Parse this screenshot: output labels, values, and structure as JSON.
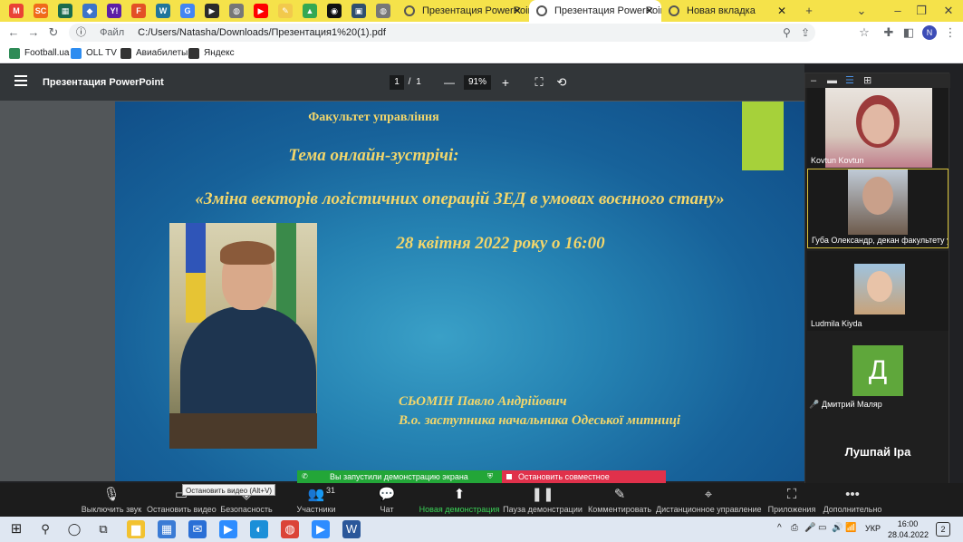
{
  "browser": {
    "mini_tabs": [
      {
        "icon": "gmail-icon",
        "glyph": "M",
        "color": "#ea4335"
      },
      {
        "icon": "sc-icon",
        "glyph": "SC",
        "color": "#f06a1b"
      },
      {
        "icon": "grid-app-icon",
        "glyph": "▦",
        "color": "#1a6b4d"
      },
      {
        "icon": "diamond-app-icon",
        "glyph": "◆",
        "color": "#3c74c9"
      },
      {
        "icon": "yahoo-icon",
        "glyph": "Y!",
        "color": "#5c1ea6"
      },
      {
        "icon": "f-app-icon",
        "glyph": "F",
        "color": "#e34f26"
      },
      {
        "icon": "wordpress-icon",
        "glyph": "W",
        "color": "#21759b"
      },
      {
        "icon": "google-icon",
        "glyph": "G",
        "color": "#4285f4"
      },
      {
        "icon": "play-app-icon",
        "glyph": "▶",
        "color": "#2b2b2b"
      },
      {
        "icon": "globe-icon",
        "glyph": "◍",
        "color": "#777777"
      },
      {
        "icon": "youtube-icon",
        "glyph": "▶",
        "color": "#ff0000"
      },
      {
        "icon": "note-icon",
        "glyph": "✎",
        "color": "#f2c94c"
      },
      {
        "icon": "drive-icon",
        "glyph": "▲",
        "color": "#34a853"
      },
      {
        "icon": "loop-app-icon",
        "glyph": "◉",
        "color": "#111111"
      },
      {
        "icon": "page-app-icon",
        "glyph": "▣",
        "color": "#2f4f6f"
      },
      {
        "icon": "globe-icon",
        "glyph": "◍",
        "color": "#777777"
      }
    ],
    "tabs": [
      {
        "label": "Презентация PowerPoint",
        "close": "✕",
        "active": false
      },
      {
        "label": "Презентация PowerPoint",
        "close": "✕",
        "active": true
      },
      {
        "label": "Новая вкладка",
        "close": "✕",
        "active": false
      }
    ],
    "new_tab": "+",
    "window_controls": {
      "dropdown": "⌄",
      "minimize": "–",
      "restore": "❐",
      "close": "✕"
    },
    "nav": {
      "back": "←",
      "forward": "→",
      "reload": "↻"
    },
    "address": {
      "info": "ⓘ",
      "scheme_label": "Файл",
      "url": "C:/Users/Natasha/Downloads/Презентация1%20(1).pdf"
    },
    "omni_icons": {
      "zoom": "⚲",
      "share": "⇪",
      "star": "☆"
    },
    "right_icons": {
      "extensions": "✚",
      "sidepanel": "◧"
    },
    "avatar": "N",
    "menu": "⋮",
    "bookmarks": [
      {
        "label": "Football.ua",
        "color": "#2e8b57"
      },
      {
        "label": "OLL TV",
        "color": "#2d8cf0"
      },
      {
        "label": "Авиабилеты",
        "color": "#333333"
      },
      {
        "label": "Яндекс",
        "color": "#333333"
      }
    ]
  },
  "pdf": {
    "title": "Презентация PowerPoint",
    "page_current": "1",
    "page_sep": "/",
    "page_total": "1",
    "zoom_minus": "—",
    "zoom": "91%",
    "zoom_plus": "+",
    "fit_icon": "⛶",
    "rotate_icon": "⟲"
  },
  "slide": {
    "faculty": "Факультет управління",
    "topic_label": "Тема онлайн-зустрічі:",
    "topic": "«Зміна векторів логістичних операцій ЗЕД в умовах воєнного стану»",
    "date": "28 квітня 2022 року  о 16:00",
    "speaker_name": "СЬОМІН Павло Андрійович",
    "speaker_title": "В.о. заступника начальника Одеської митниці"
  },
  "zoom": {
    "panel_top": [
      "–",
      "▬",
      "☰",
      "⊞"
    ],
    "participants": [
      {
        "name": "Kovtun Kovtun"
      },
      {
        "name": "Губа Олександр, декан факультету у..."
      },
      {
        "name": "Ludmila Kiyda"
      },
      {
        "name": "Дмитрий Маляр",
        "avatar_letter": "Д",
        "muted_icon": "🎤"
      },
      {
        "name": "Лушпай Іра"
      }
    ],
    "scroll_icon": "⌄",
    "banner_green": "Вы запустили демонстрацию экрана",
    "banner_red": "Остановить совместное использование",
    "tooltip": "Остановить видео (Alt+V)",
    "toolbar": [
      {
        "label": "Выключить звук",
        "icon": "🎙"
      },
      {
        "label": "Остановить видео",
        "icon": "▭"
      },
      {
        "label": "Безопасность",
        "icon": "◈"
      },
      {
        "label": "Участники",
        "icon": "👥",
        "count": "31"
      },
      {
        "label": "Чат",
        "icon": "💬"
      },
      {
        "label": "Новая демонстрация",
        "icon": "⬆"
      },
      {
        "label": "Пауза демонстрации",
        "icon": "❚❚"
      },
      {
        "label": "Комментировать",
        "icon": "✎"
      },
      {
        "label": "Дистанционное управление",
        "icon": "⌖"
      },
      {
        "label": "Приложения",
        "icon": "⛶"
      },
      {
        "label": "Дополнительно",
        "icon": "•••"
      }
    ]
  },
  "taskbar": {
    "start": "⊞",
    "search": "⚲",
    "cortana": "◯",
    "taskview": "⧉",
    "apps": [
      {
        "icon": "explorer-icon",
        "glyph": "▆",
        "color": "#f2c230"
      },
      {
        "icon": "store-icon",
        "glyph": "▦",
        "color": "#3a7bd5"
      },
      {
        "icon": "mail-icon",
        "glyph": "✉",
        "color": "#2a6fd6"
      },
      {
        "icon": "zoom-icon",
        "glyph": "▶",
        "color": "#2d8cff"
      },
      {
        "icon": "edge-icon",
        "glyph": "◐",
        "color": "#1b8fd8"
      },
      {
        "icon": "chrome-icon",
        "glyph": "◍",
        "color": "#db4437"
      },
      {
        "icon": "zoom-meeting-icon",
        "glyph": "▶",
        "color": "#2d8cff"
      },
      {
        "icon": "word-icon",
        "glyph": "W",
        "color": "#2b579a"
      }
    ],
    "tray": [
      "^",
      "⎙",
      "🎤",
      "▭",
      "🔊",
      "📶"
    ],
    "lang": "УКР",
    "time": "16:00",
    "date": "28.04.2022",
    "notif": "2"
  }
}
